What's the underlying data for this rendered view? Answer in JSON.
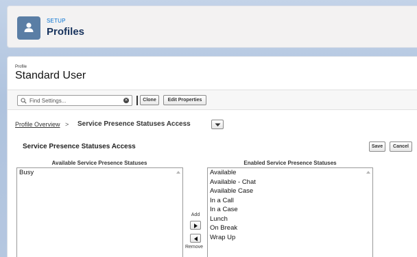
{
  "header": {
    "eyebrow": "SETUP",
    "title": "Profiles",
    "icon": "user-icon",
    "icon_color": "#5a7ea5"
  },
  "profile": {
    "eyebrow": "Profile",
    "name": "Standard User"
  },
  "toolbar": {
    "search_placeholder": "Find Settings...",
    "clone_label": "Clone",
    "edit_properties_label": "Edit Properties"
  },
  "breadcrumb": {
    "link": "Profile Overview",
    "separator": ">",
    "current": "Service Presence Statuses Access"
  },
  "section": {
    "title": "Service Presence Statuses Access",
    "save_label": "Save",
    "cancel_label": "Cancel"
  },
  "available": {
    "header": "Available Service Presence Statuses",
    "items": [
      "Busy"
    ]
  },
  "enabled": {
    "header": "Enabled Service Presence Statuses",
    "items": [
      "Available",
      "Available - Chat",
      "Available Case",
      "In a Call",
      "In a Case",
      "Lunch",
      "On Break",
      "Wrap Up"
    ]
  },
  "mover": {
    "add_label": "Add",
    "remove_label": "Remove"
  }
}
